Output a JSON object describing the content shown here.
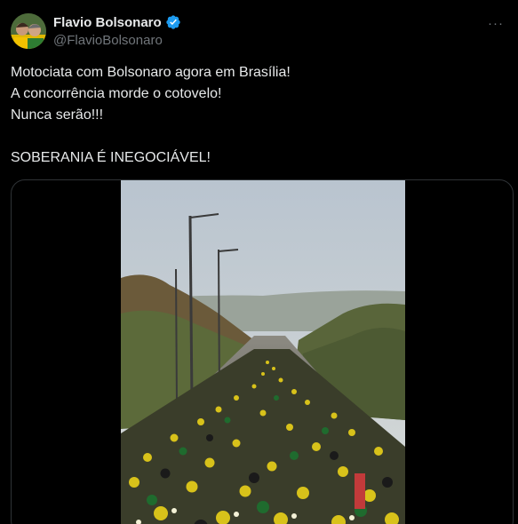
{
  "author": {
    "name": "Flavio Bolsonaro",
    "handle": "@FlavioBolsonaro",
    "avatar_icon": "profile-photo-avatar",
    "verified_icon": "verified-badge-icon",
    "verified_color": "#1d9bf0"
  },
  "menu": {
    "more_icon": "ellipsis-icon",
    "more_label": "···"
  },
  "tweet": {
    "line1": "Motociata com Bolsonaro agora em Brasília!",
    "line2": "A concorrência morde o cotovelo!",
    "line3": "Nunca serão!!!",
    "line4": "",
    "line5": "SOBERANIA É INEGOCIÁVEL!"
  },
  "media": {
    "type": "video",
    "scene_icon": "motorcycle-rally-video"
  },
  "colors": {
    "background": "#000000",
    "text": "#e7e9ea",
    "secondary_text": "#71767b",
    "border": "#2f3336"
  }
}
